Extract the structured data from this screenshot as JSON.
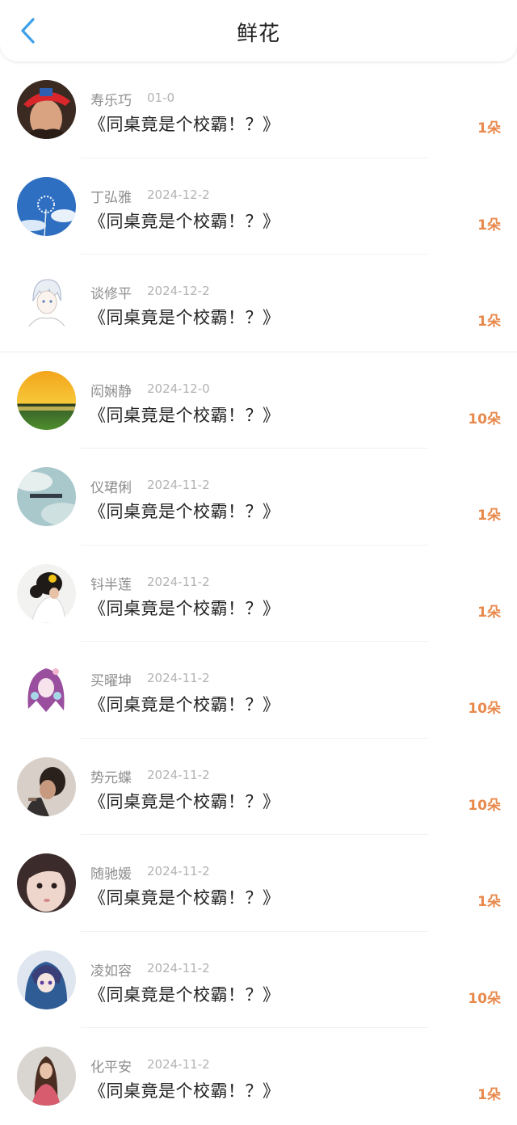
{
  "header": {
    "title": "鲜花",
    "back_icon": "chevron-left-icon",
    "accent": "#3ea0e8"
  },
  "count_color": "#e8894c",
  "gifts": [
    {
      "name": "寿乐巧",
      "date": "01-0",
      "book": "《同桌竟是个校霸！？》",
      "count": "1朵",
      "avatar": "girl-red-cap"
    },
    {
      "name": "丁弘雅",
      "date": "2024-12-2",
      "book": "《同桌竟是个校霸！？》",
      "count": "1朵",
      "avatar": "dandelion-sky"
    },
    {
      "name": "谈修平",
      "date": "2024-12-2",
      "book": "《同桌竟是个校霸！？》",
      "count": "1朵",
      "avatar": "anime-white-hair"
    },
    {
      "name": "闳娴静",
      "date": "2024-12-0",
      "book": "《同桌竟是个校霸！？》",
      "count": "10朵",
      "avatar": "sunset-field"
    },
    {
      "name": "仪珺俐",
      "date": "2024-11-2",
      "book": "《同桌竟是个校霸！？》",
      "count": "1朵",
      "avatar": "cloudy-sky"
    },
    {
      "name": "钭半莲",
      "date": "2024-11-2",
      "book": "《同桌竟是个校霸！？》",
      "count": "1朵",
      "avatar": "girl-flower-hair"
    },
    {
      "name": "买曜坤",
      "date": "2024-11-2",
      "book": "《同桌竟是个校霸！？》",
      "count": "10朵",
      "avatar": "anime-purple-hair"
    },
    {
      "name": "势元蝶",
      "date": "2024-11-2",
      "book": "《同桌竟是个校霸！？》",
      "count": "10朵",
      "avatar": "boy-hand-head"
    },
    {
      "name": "随驰媛",
      "date": "2024-11-2",
      "book": "《同桌竟是个校霸！？》",
      "count": "1朵",
      "avatar": "girl-face-closeup"
    },
    {
      "name": "凌如容",
      "date": "2024-11-2",
      "book": "《同桌竟是个校霸！？》",
      "count": "10朵",
      "avatar": "anime-blue-hood"
    },
    {
      "name": "化平安",
      "date": "2024-11-2",
      "book": "《同桌竟是个校霸！？》",
      "count": "1朵",
      "avatar": "girl-long-hair"
    }
  ]
}
